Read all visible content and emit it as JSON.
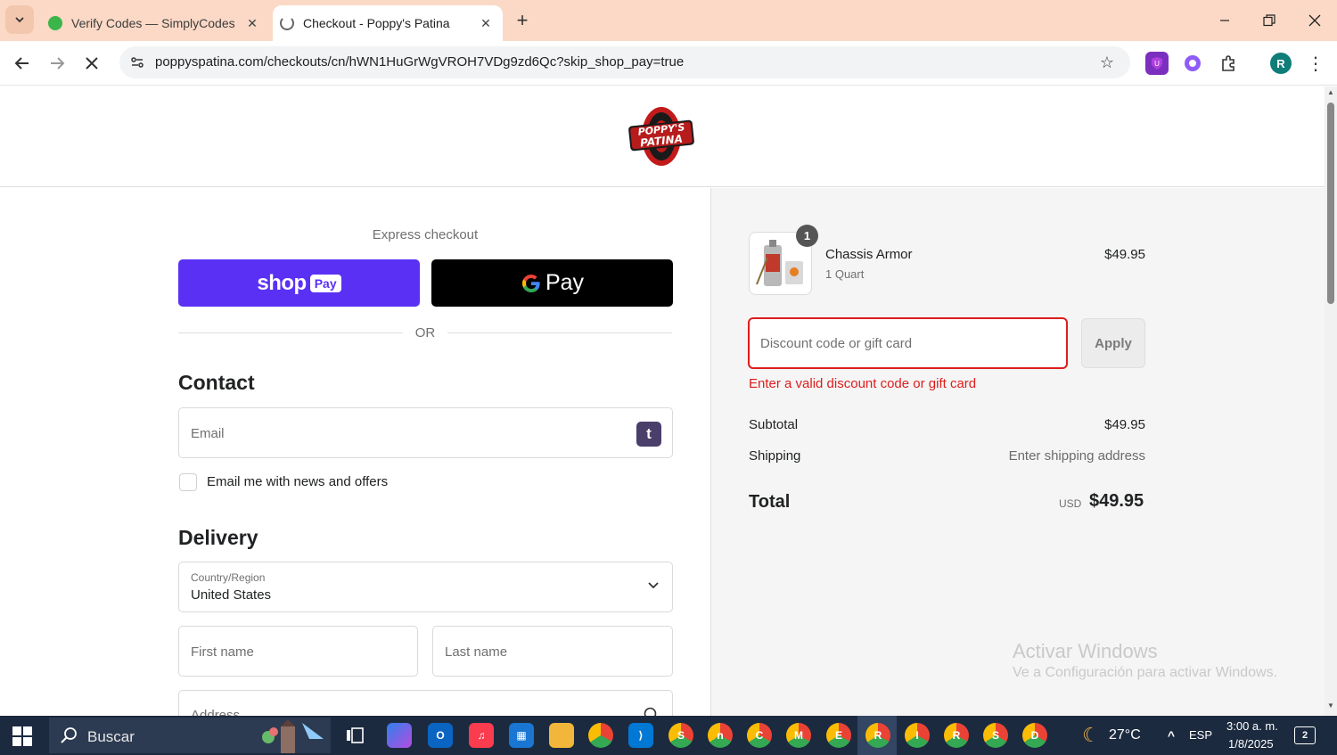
{
  "browser": {
    "tabs": [
      {
        "label": "Verify Codes — SimplyCodes",
        "active": false
      },
      {
        "label": "Checkout - Poppy's Patina",
        "active": true
      }
    ],
    "url": "poppyspatina.com/checkouts/cn/hWN1HuGrWgVROH7VDg9zd6Qc?skip_shop_pay=true",
    "avatar_letter": "R"
  },
  "logo": {
    "line1": "POPPY'S",
    "line2": "PATINA"
  },
  "checkout": {
    "express_title": "Express checkout",
    "shop_pay": {
      "brand": "shop",
      "badge": "Pay"
    },
    "google_pay": {
      "label": "Pay"
    },
    "or_text": "OR",
    "contact": {
      "heading": "Contact",
      "email_placeholder": "Email",
      "badge": "t",
      "newsletter_label": "Email me with news and offers"
    },
    "delivery": {
      "heading": "Delivery",
      "country_label": "Country/Region",
      "country_value": "United States",
      "first_name_placeholder": "First name",
      "last_name_placeholder": "Last name",
      "address_placeholder": "Address"
    }
  },
  "summary": {
    "item": {
      "quantity": "1",
      "name": "Chassis Armor",
      "variant": "1 Quart",
      "price": "$49.95"
    },
    "discount_placeholder": "Discount code or gift card",
    "apply_label": "Apply",
    "discount_error": "Enter a valid discount code or gift card",
    "subtotal_label": "Subtotal",
    "subtotal_value": "$49.95",
    "shipping_label": "Shipping",
    "shipping_value": "Enter shipping address",
    "total_label": "Total",
    "total_currency": "USD",
    "total_value": "$49.95"
  },
  "watermark": {
    "title": "Activar Windows",
    "subtitle": "Ve a Configuración para activar Windows."
  },
  "taskbar": {
    "search_text": "Buscar",
    "weather": "27°C",
    "language": "ESP",
    "time": "3:00 a. m.",
    "date": "1/8/2025",
    "notifications": "2"
  },
  "colors": {
    "tabbar": "#fbd9c6",
    "shop_pay": "#5a31f4",
    "error": "#dd1d1d",
    "summary_bg": "#f5f5f5",
    "taskbar": "#1c2a3f"
  }
}
